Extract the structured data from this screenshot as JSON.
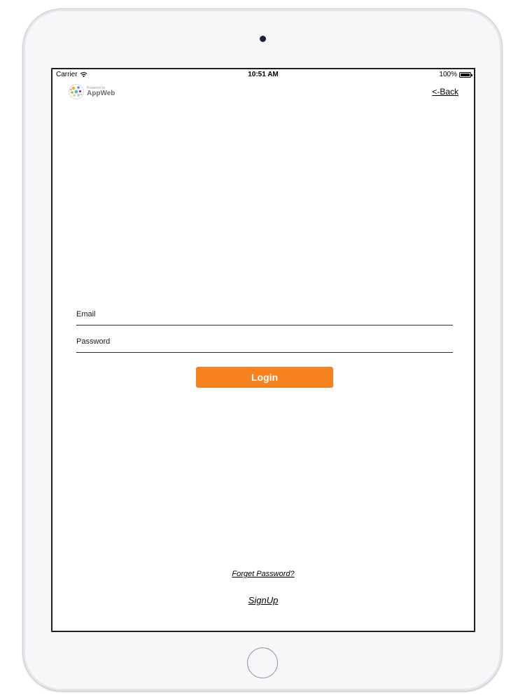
{
  "status_bar": {
    "carrier": "Carrier",
    "time": "10:51 AM",
    "battery_percent": "100%",
    "battery_level": 1.0,
    "wifi_icon": "wifi-icon",
    "battery_icon": "battery-icon"
  },
  "header": {
    "logo_powered_by": "Powered by",
    "logo_name": "AppWeb",
    "back_label": "<-Back"
  },
  "form": {
    "email_placeholder": "Email",
    "email_value": "",
    "password_placeholder": "Password",
    "password_value": "",
    "login_label": "Login"
  },
  "footer": {
    "forgot_password_label": "Forget Password?",
    "signup_label": "SignUp"
  },
  "colors": {
    "accent": "#f5821f",
    "screen_background": "#ffffff",
    "device_frame": "#f6f7f9",
    "text": "#000000"
  }
}
